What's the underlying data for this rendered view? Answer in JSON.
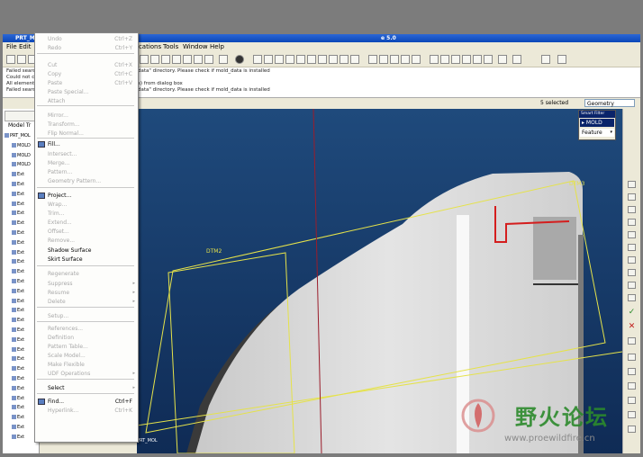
{
  "window": {
    "title_left": "PRT_MOL",
    "title_right": "e 5.0"
  },
  "menubar": {
    "items": [
      "File",
      "Edit",
      "ications",
      "Tools",
      "Window",
      "Help"
    ]
  },
  "messages": {
    "left": [
      "Failed searc",
      "Could not ch",
      "All elements",
      "Failed searc"
    ],
    "right": [
      "data\" directory. Please check if mold_data is installed",
      "",
      "s) from dialog box",
      "data\" directory. Please check if mold_data is installed"
    ]
  },
  "status": {
    "selected": "5 selected",
    "filter": "Geometry"
  },
  "leftpanel": {
    "tab_label": "Model Tr",
    "rows": [
      "PRT_MOL",
      "MOLD",
      "MOLD",
      "MOLD",
      "Ext",
      "Ext",
      "Ext",
      "Ext",
      "Ext",
      "Ext",
      "Ext",
      "Ext",
      "Ext",
      "Ext",
      "Ext",
      "Ext",
      "Ext",
      "Ext",
      "Ext",
      "Ext",
      "Ext",
      "Ext",
      "Ext",
      "Ext",
      "Ext",
      "Ext",
      "Ext",
      "Ext",
      "Ext",
      "Ext",
      "Ext",
      "Ext"
    ]
  },
  "edit_menu": {
    "items": [
      {
        "label": "Undo",
        "shortcut": "Ctrl+Z",
        "enabled": false
      },
      {
        "label": "Redo",
        "shortcut": "Ctrl+Y",
        "enabled": false
      },
      {
        "label": "Cut",
        "shortcut": "Ctrl+X",
        "enabled": false
      },
      {
        "label": "Copy",
        "shortcut": "Ctrl+C",
        "enabled": false
      },
      {
        "label": "Paste",
        "shortcut": "Ctrl+V",
        "enabled": false
      },
      {
        "label": "Paste Special...",
        "shortcut": "",
        "enabled": false
      },
      {
        "label": "Attach",
        "shortcut": "",
        "enabled": false
      },
      {
        "label": "Mirror...",
        "shortcut": "",
        "enabled": false
      },
      {
        "label": "Transform...",
        "shortcut": "",
        "enabled": false
      },
      {
        "label": "Flip Normal...",
        "shortcut": "",
        "enabled": false
      },
      {
        "label": "Fill...",
        "shortcut": "",
        "enabled": true
      },
      {
        "label": "Intersect...",
        "shortcut": "",
        "enabled": false
      },
      {
        "label": "Merge...",
        "shortcut": "",
        "enabled": false
      },
      {
        "label": "Pattern...",
        "shortcut": "",
        "enabled": false
      },
      {
        "label": "Geometry Pattern...",
        "shortcut": "",
        "enabled": false
      },
      {
        "label": "Project...",
        "shortcut": "",
        "enabled": true
      },
      {
        "label": "Wrap...",
        "shortcut": "",
        "enabled": false
      },
      {
        "label": "Trim...",
        "shortcut": "",
        "enabled": false
      },
      {
        "label": "Extend...",
        "shortcut": "",
        "enabled": false
      },
      {
        "label": "Offset...",
        "shortcut": "",
        "enabled": false
      },
      {
        "label": "Remove...",
        "shortcut": "",
        "enabled": false
      },
      {
        "label": "Shadow Surface",
        "shortcut": "",
        "enabled": true
      },
      {
        "label": "Skirt Surface",
        "shortcut": "",
        "enabled": true
      },
      {
        "label": "Regenerate",
        "shortcut": "",
        "enabled": false
      },
      {
        "label": "Suppress",
        "shortcut": "",
        "enabled": false
      },
      {
        "label": "Resume",
        "shortcut": "",
        "enabled": false
      },
      {
        "label": "Delete",
        "shortcut": "",
        "enabled": false
      },
      {
        "label": "Setup...",
        "shortcut": "",
        "enabled": false
      },
      {
        "label": "References...",
        "shortcut": "",
        "enabled": false
      },
      {
        "label": "Definition",
        "shortcut": "",
        "enabled": false
      },
      {
        "label": "Pattern Table...",
        "shortcut": "",
        "enabled": false
      },
      {
        "label": "Scale Model...",
        "shortcut": "",
        "enabled": false
      },
      {
        "label": "Make Flexible",
        "shortcut": "",
        "enabled": false
      },
      {
        "label": "UDF Operations",
        "shortcut": "",
        "enabled": false
      },
      {
        "label": "Select",
        "shortcut": "",
        "enabled": true
      },
      {
        "label": "Find...",
        "shortcut": "Ctrl+F",
        "enabled": true
      },
      {
        "label": "Hyperlink...",
        "shortcut": "Ctrl+K",
        "enabled": false
      }
    ]
  },
  "viewport": {
    "datums": [
      "DTM3",
      "DTM2"
    ],
    "ref_label": "PRT_MOL"
  },
  "smart_filter": {
    "header": "Smart Filter",
    "options": [
      "MOLD",
      "Feature"
    ]
  },
  "watermark": {
    "text": "野火论坛",
    "url": "www.proewildfire.cn"
  },
  "colors": {
    "viewport_bg": "#1a3f70",
    "datum_yellow": "#e5e24a",
    "selection_red": "#d41e1e",
    "title_blue": "#0b47b8"
  }
}
